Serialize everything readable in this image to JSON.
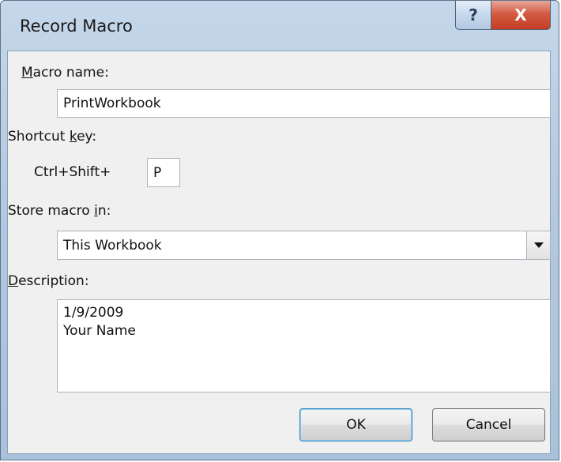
{
  "window": {
    "title": "Record Macro",
    "help_glyph": "?",
    "close_glyph": "X"
  },
  "macro_name": {
    "label_accel": "M",
    "label_rest": "acro name:",
    "value": "PrintWorkbook"
  },
  "shortcut": {
    "label_pre": "Shortcut ",
    "label_accel": "k",
    "label_post": "ey:",
    "modifier_text": "Ctrl+Shift+",
    "key_value": "P"
  },
  "store": {
    "label_pre": "Store macro ",
    "label_accel": "i",
    "label_post": "n:",
    "selected": "This Workbook"
  },
  "description": {
    "label_accel": "D",
    "label_rest": "escription:",
    "line1": "1/9/2009",
    "line2": "Your Name"
  },
  "buttons": {
    "ok": "OK",
    "cancel": "Cancel"
  },
  "icons": {
    "help": "help-icon",
    "close": "close-icon",
    "dropdown": "chevron-down-icon"
  }
}
